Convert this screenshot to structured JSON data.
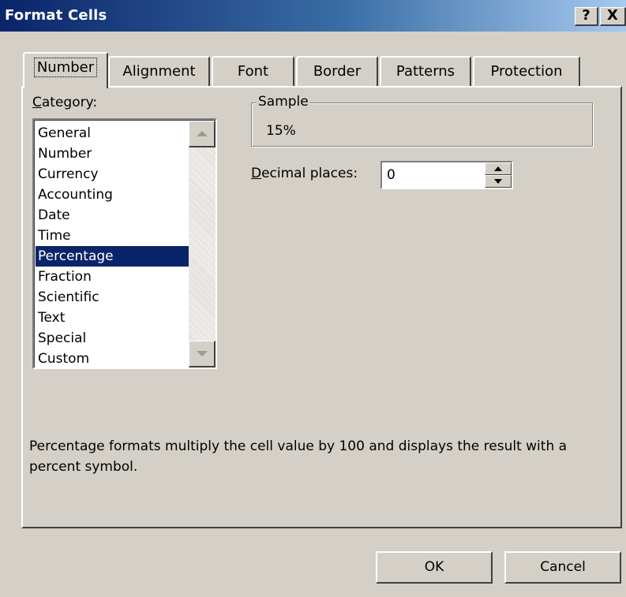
{
  "window": {
    "title": "Format Cells",
    "help_glyph": "?",
    "close_glyph": "X"
  },
  "tabs": [
    {
      "label": "Number",
      "active": true
    },
    {
      "label": "Alignment",
      "active": false
    },
    {
      "label": "Font",
      "active": false
    },
    {
      "label": "Border",
      "active": false
    },
    {
      "label": "Patterns",
      "active": false
    },
    {
      "label": "Protection",
      "active": false
    }
  ],
  "category": {
    "label_mnemonic": "C",
    "label_rest": "ategory:",
    "items": [
      "General",
      "Number",
      "Currency",
      "Accounting",
      "Date",
      "Time",
      "Percentage",
      "Fraction",
      "Scientific",
      "Text",
      "Special",
      "Custom"
    ],
    "selected": "Percentage"
  },
  "sample": {
    "label": "Sample",
    "value": "15%"
  },
  "decimal": {
    "label_mnemonic": "D",
    "label_rest": "ecimal places:",
    "value": "0"
  },
  "description": "Percentage formats multiply the cell value by 100 and displays the result with a percent symbol.",
  "buttons": {
    "ok": "OK",
    "cancel": "Cancel"
  },
  "icons": {
    "scroll_up": "scroll-up-arrow-icon",
    "scroll_down": "scroll-down-arrow-icon",
    "spin_up": "spin-up-arrow-icon",
    "spin_down": "spin-down-arrow-icon"
  },
  "colors": {
    "title_bar_start": "#0a246a",
    "title_bar_end": "#a6caf0",
    "dialog_face": "#d4d0c8",
    "selection": "#0a246a"
  }
}
